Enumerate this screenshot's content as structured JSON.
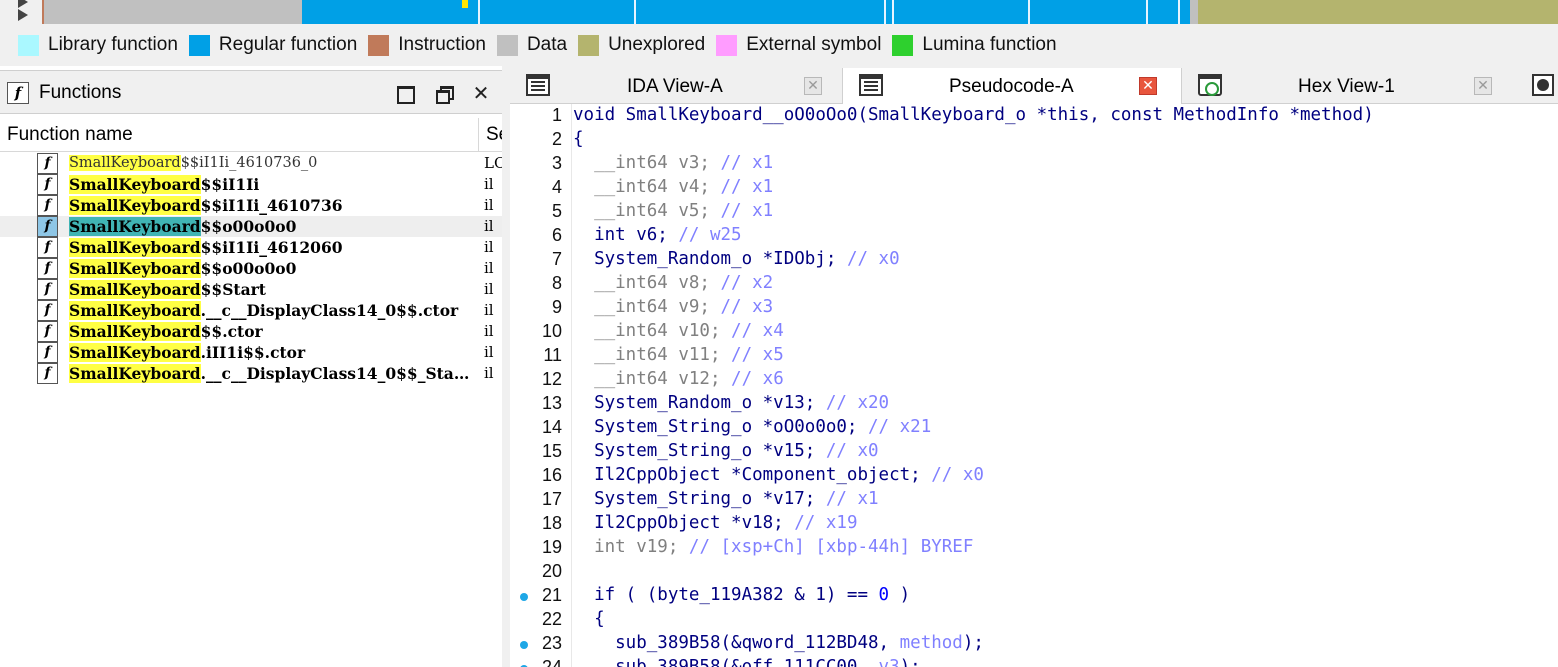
{
  "legend": [
    {
      "label": "Library function",
      "color": "#aaf8ff"
    },
    {
      "label": "Regular function",
      "color": "#00a0e6"
    },
    {
      "label": "Instruction",
      "color": "#c07a5a"
    },
    {
      "label": "Data",
      "color": "#c0c0c0"
    },
    {
      "label": "Unexplored",
      "color": "#b4b46e"
    },
    {
      "label": "External symbol",
      "color": "#ff9cff"
    },
    {
      "label": "Lumina function",
      "color": "#2ed02e"
    }
  ],
  "functions_panel": {
    "title": "Functions",
    "col_name": "Function name",
    "col_segment": "Se",
    "rows": [
      {
        "prefix": "SmallKeyboard",
        "suffix": "$$iI1Ii_4610736_0",
        "seg": "LO"
      },
      {
        "prefix": "SmallKeyboard",
        "suffix": "$$iI1Ii",
        "seg": "il"
      },
      {
        "prefix": "SmallKeyboard",
        "suffix": "$$iI1Ii_4610736",
        "seg": "il"
      },
      {
        "prefix": "SmallKeyboard",
        "suffix": "$$o00o0o0",
        "seg": "il"
      },
      {
        "prefix": "SmallKeyboard",
        "suffix": "$$iI1Ii_4612060",
        "seg": "il"
      },
      {
        "prefix": "SmallKeyboard",
        "suffix": "$$o00o0o0",
        "seg": "il"
      },
      {
        "prefix": "SmallKeyboard",
        "suffix": "$$Start",
        "seg": "il"
      },
      {
        "prefix": "SmallKeyboard",
        "suffix": ".__c__DisplayClass14_0$$.ctor",
        "seg": "il"
      },
      {
        "prefix": "SmallKeyboard",
        "suffix": "$$.ctor",
        "seg": "il"
      },
      {
        "prefix": "SmallKeyboard",
        "suffix": ".iII1i$$.ctor",
        "seg": "il"
      },
      {
        "prefix": "SmallKeyboard",
        "suffix": ".__c__DisplayClass14_0$$_Sta…",
        "seg": "il"
      }
    ]
  },
  "tabs": [
    {
      "label": "IDA View-A"
    },
    {
      "label": "Pseudocode-A"
    },
    {
      "label": "Hex View-1"
    }
  ],
  "code": {
    "l1": "void SmallKeyboard__oO0oOo0(SmallKeyboard_o *this, const MethodInfo *method)",
    "l2": "{",
    "l3a": "  __int64 v3; ",
    "l3c": "// x1",
    "l4a": "  __int64 v4; ",
    "l4c": "// x1",
    "l5a": "  __int64 v5; ",
    "l5c": "// x1",
    "l6a": "  int v6; ",
    "l6c": "// w25",
    "l7a": "  System_Random_o *IDObj; ",
    "l7c": "// x0",
    "l8a": "  __int64 v8; ",
    "l8c": "// x2",
    "l9a": "  __int64 v9; ",
    "l9c": "// x3",
    "l10a": "  __int64 v10; ",
    "l10c": "// x4",
    "l11a": "  __int64 v11; ",
    "l11c": "// x5",
    "l12a": "  __int64 v12; ",
    "l12c": "// x6",
    "l13a": "  System_Random_o *v13; ",
    "l13c": "// x20",
    "l14a": "  System_String_o *oO0o0o0; ",
    "l14c": "// x21",
    "l15a": "  System_String_o *v15; ",
    "l15c": "// x0",
    "l16a": "  Il2CppObject *Component_object; ",
    "l16c": "// x0",
    "l17a": "  System_String_o *v17; ",
    "l17c": "// x1",
    "l18a": "  Il2CppObject *v18; ",
    "l18c": "// x19",
    "l19a": "  int v19; ",
    "l19c": "// [xsp+Ch] [xbp-44h] BYREF",
    "l20": "",
    "l21a": "  if ( (byte_119A382 & 1) == ",
    "l21n": "0",
    "l21b": " )",
    "l22": "  {",
    "l23a": "    sub_389B58(&qword_112BD48, ",
    "l23m": "method",
    "l23b": ");",
    "l24a": "    sub_389B58(&off_111CC00, ",
    "l24m": "v3",
    "l24b": ");"
  }
}
